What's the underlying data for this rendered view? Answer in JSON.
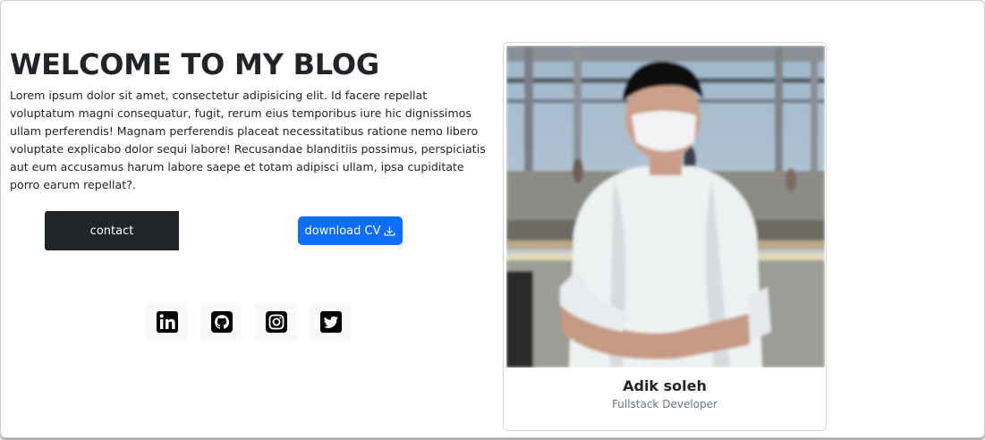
{
  "hero": {
    "title": "WELCOME TO MY BLOG",
    "text": "Lorem ipsum dolor sit amet, consectetur adipisicing elit. Id facere repellat voluptatum magni consequatur, fugit, rerum eius temporibus iure hic dignissimos ullam perferendis! Magnam perferendis placeat necessitatibus ratione nemo libero voluptate explicabo dolor sequi labore! Recusandae blanditiis possimus, perspiciatis aut eum accusamus harum labore saepe et totam adipisci ullam, ipsa cupiditate porro earum repellat?."
  },
  "buttons": {
    "contact_label": "contact",
    "download_label": "download CV",
    "download_icon": "download-icon"
  },
  "socials": [
    {
      "name": "linkedin-icon"
    },
    {
      "name": "github-icon"
    },
    {
      "name": "instagram-icon"
    },
    {
      "name": "twitter-icon"
    }
  ],
  "profile": {
    "name": "Adik soleh",
    "role": "Fullstack Developer",
    "photo": "profile-photo"
  },
  "colors": {
    "primary": "#0d6efd",
    "dark": "#212529",
    "muted": "#6c757d"
  }
}
